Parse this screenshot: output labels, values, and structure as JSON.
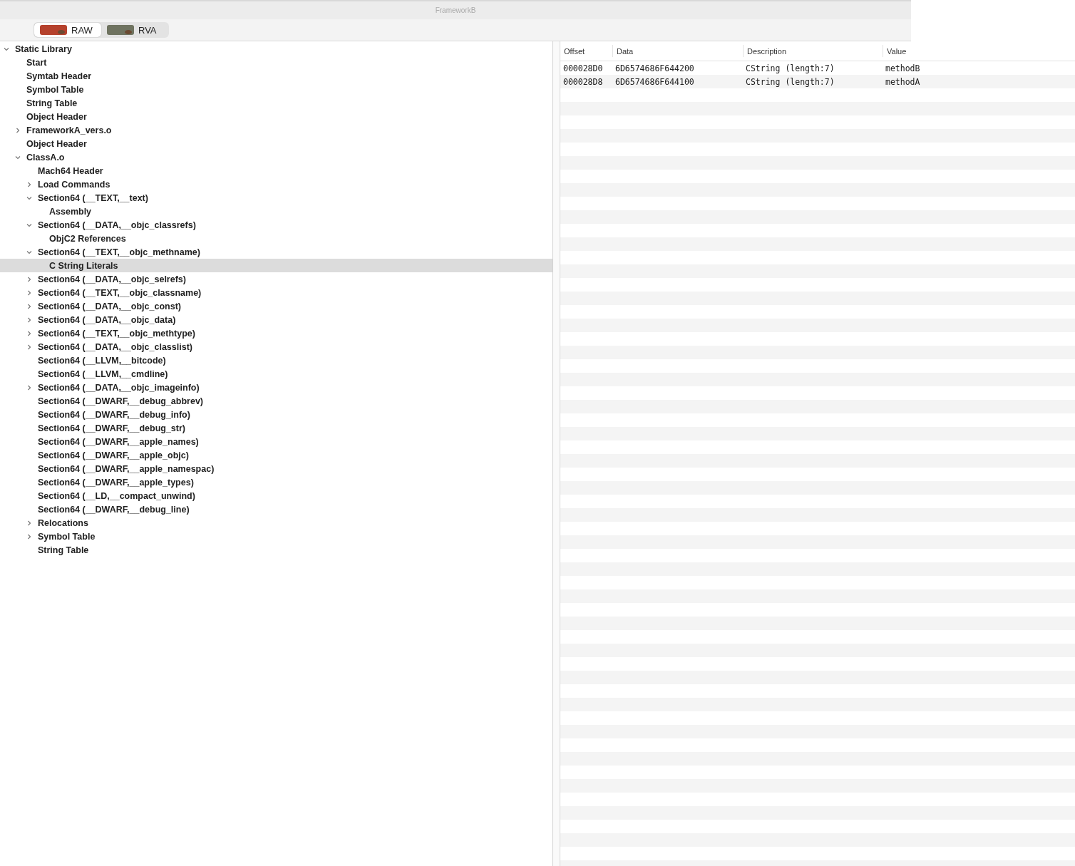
{
  "window": {
    "title": "FrameworkB"
  },
  "toolbar": {
    "segments": [
      {
        "label": "RAW",
        "selected": true
      },
      {
        "label": "RVA",
        "selected": false
      }
    ]
  },
  "tree": [
    {
      "label": "Static Library",
      "expanded": true,
      "selected": false,
      "children": [
        {
          "label": "Start",
          "selected": false
        },
        {
          "label": "Symtab Header",
          "selected": false
        },
        {
          "label": "Symbol Table",
          "selected": false
        },
        {
          "label": "String Table",
          "selected": false
        },
        {
          "label": "Object Header",
          "selected": false
        },
        {
          "label": "FrameworkA_vers.o",
          "expanded": false,
          "selected": false
        },
        {
          "label": "Object Header",
          "selected": false
        },
        {
          "label": "ClassA.o",
          "expanded": true,
          "selected": false,
          "children": [
            {
              "label": "Mach64 Header",
              "selected": false
            },
            {
              "label": "Load Commands",
              "expanded": false,
              "selected": false
            },
            {
              "label": "Section64 (__TEXT,__text)",
              "expanded": true,
              "selected": false,
              "children": [
                {
                  "label": "Assembly",
                  "selected": false
                }
              ]
            },
            {
              "label": "Section64 (__DATA,__objc_classrefs)",
              "expanded": true,
              "selected": false,
              "children": [
                {
                  "label": "ObjC2 References",
                  "selected": false
                }
              ]
            },
            {
              "label": "Section64 (__TEXT,__objc_methname)",
              "expanded": true,
              "selected": false,
              "children": [
                {
                  "label": "C String Literals",
                  "selected": true
                }
              ]
            },
            {
              "label": "Section64 (__DATA,__objc_selrefs)",
              "expanded": false,
              "selected": false
            },
            {
              "label": "Section64 (__TEXT,__objc_classname)",
              "expanded": false,
              "selected": false
            },
            {
              "label": "Section64 (__DATA,__objc_const)",
              "expanded": false,
              "selected": false
            },
            {
              "label": "Section64 (__DATA,__objc_data)",
              "expanded": false,
              "selected": false
            },
            {
              "label": "Section64 (__TEXT,__objc_methtype)",
              "expanded": false,
              "selected": false
            },
            {
              "label": "Section64 (__DATA,__objc_classlist)",
              "expanded": false,
              "selected": false
            },
            {
              "label": "Section64 (__LLVM,__bitcode)",
              "selected": false
            },
            {
              "label": "Section64 (__LLVM,__cmdline)",
              "selected": false
            },
            {
              "label": "Section64 (__DATA,__objc_imageinfo)",
              "expanded": false,
              "selected": false
            },
            {
              "label": "Section64 (__DWARF,__debug_abbrev)",
              "selected": false
            },
            {
              "label": "Section64 (__DWARF,__debug_info)",
              "selected": false
            },
            {
              "label": "Section64 (__DWARF,__debug_str)",
              "selected": false
            },
            {
              "label": "Section64 (__DWARF,__apple_names)",
              "selected": false
            },
            {
              "label": "Section64 (__DWARF,__apple_objc)",
              "selected": false
            },
            {
              "label": "Section64 (__DWARF,__apple_namespac)",
              "selected": false
            },
            {
              "label": "Section64 (__DWARF,__apple_types)",
              "selected": false
            },
            {
              "label": "Section64 (__LD,__compact_unwind)",
              "selected": false
            },
            {
              "label": "Section64 (__DWARF,__debug_line)",
              "selected": false
            },
            {
              "label": "Relocations",
              "expanded": false,
              "selected": false
            },
            {
              "label": "Symbol Table",
              "expanded": false,
              "selected": false
            },
            {
              "label": "String Table",
              "selected": false
            }
          ]
        }
      ]
    }
  ],
  "table": {
    "columns": [
      "Offset",
      "Data",
      "Description",
      "Value"
    ],
    "rows": [
      [
        "000028D0",
        "6D6574686F644200",
        "CString (length:7)",
        "methodB"
      ],
      [
        "000028D8",
        "6D6574686F644100",
        "CString (length:7)",
        "methodA"
      ]
    ]
  }
}
